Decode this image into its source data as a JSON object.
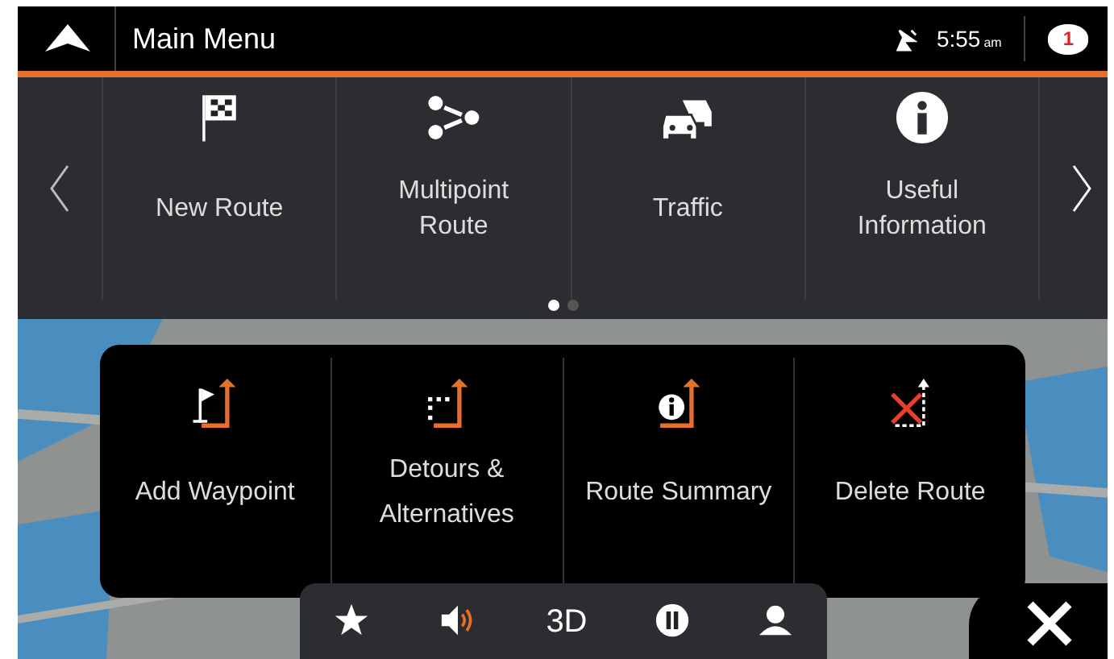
{
  "header": {
    "title": "Main Menu",
    "time": "5:55",
    "time_suffix": "am",
    "notification_count": "1"
  },
  "menu": {
    "items": [
      {
        "label": "New Route",
        "kind": "flag"
      },
      {
        "label": "Multipoint Route",
        "kind": "multipoint"
      },
      {
        "label": "Traffic",
        "kind": "traffic"
      },
      {
        "label": "Useful Information",
        "kind": "info"
      }
    ],
    "pages": [
      {
        "selected": true
      },
      {
        "selected": false
      }
    ]
  },
  "route_menu": {
    "items": [
      {
        "label": "Add Waypoint",
        "kind": "waypoint"
      },
      {
        "label": "Detours & Alternatives",
        "kind": "detour"
      },
      {
        "label": "Route Summary",
        "kind": "summary"
      },
      {
        "label": "Delete Route",
        "kind": "delete"
      }
    ]
  },
  "toolbar": {
    "items": [
      {
        "kind": "star"
      },
      {
        "kind": "sound"
      },
      {
        "kind": "text",
        "label": "3D"
      },
      {
        "kind": "pause"
      },
      {
        "kind": "person"
      }
    ]
  }
}
